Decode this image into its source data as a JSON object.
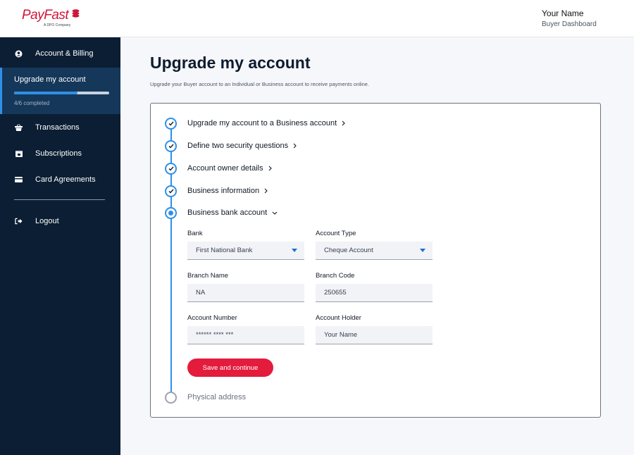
{
  "brand": {
    "name": "PayFast",
    "subtitle": "A DPO Company",
    "color": "#d0163a"
  },
  "header": {
    "user_name": "Your Name",
    "user_role": "Buyer Dashboard"
  },
  "sidebar": {
    "items": [
      {
        "label": "Account & Billing",
        "icon": "user-circle-icon"
      },
      {
        "label": "Upgrade my account",
        "progress_text": "4/6 completed",
        "progress_fraction": 0.67
      },
      {
        "label": "Transactions",
        "icon": "basket-icon"
      },
      {
        "label": "Subscriptions",
        "icon": "calendar-icon"
      },
      {
        "label": "Card Agreements",
        "icon": "card-icon"
      },
      {
        "label": "Logout",
        "icon": "logout-icon"
      }
    ]
  },
  "main": {
    "title": "Upgrade my account",
    "subtitle": "Upgrade your Buyer account to an Individual or Business account to receive payments online."
  },
  "steps": [
    {
      "label": "Upgrade my account to a Business account",
      "state": "complete"
    },
    {
      "label": "Define two security questions",
      "state": "complete"
    },
    {
      "label": "Account owner details",
      "state": "complete"
    },
    {
      "label": "Business information",
      "state": "complete"
    },
    {
      "label": "Business bank account",
      "state": "current"
    },
    {
      "label": "Physical address",
      "state": "pending"
    }
  ],
  "form": {
    "bank": {
      "label": "Bank",
      "value": "First National Bank"
    },
    "account_type": {
      "label": "Account Type",
      "value": "Cheque Account"
    },
    "branch_name": {
      "label": "Branch Name",
      "value": "NA"
    },
    "branch_code": {
      "label": "Branch Code",
      "value": "250655"
    },
    "account_number": {
      "label": "Account Number",
      "value": "****** **** ***"
    },
    "account_holder": {
      "label": "Account Holder",
      "value": "Your Name"
    },
    "submit_label": "Save and continue"
  },
  "colors": {
    "accent": "#2e90e8",
    "sidebar_bg": "#0b1e33",
    "button": "#e31b3c"
  }
}
